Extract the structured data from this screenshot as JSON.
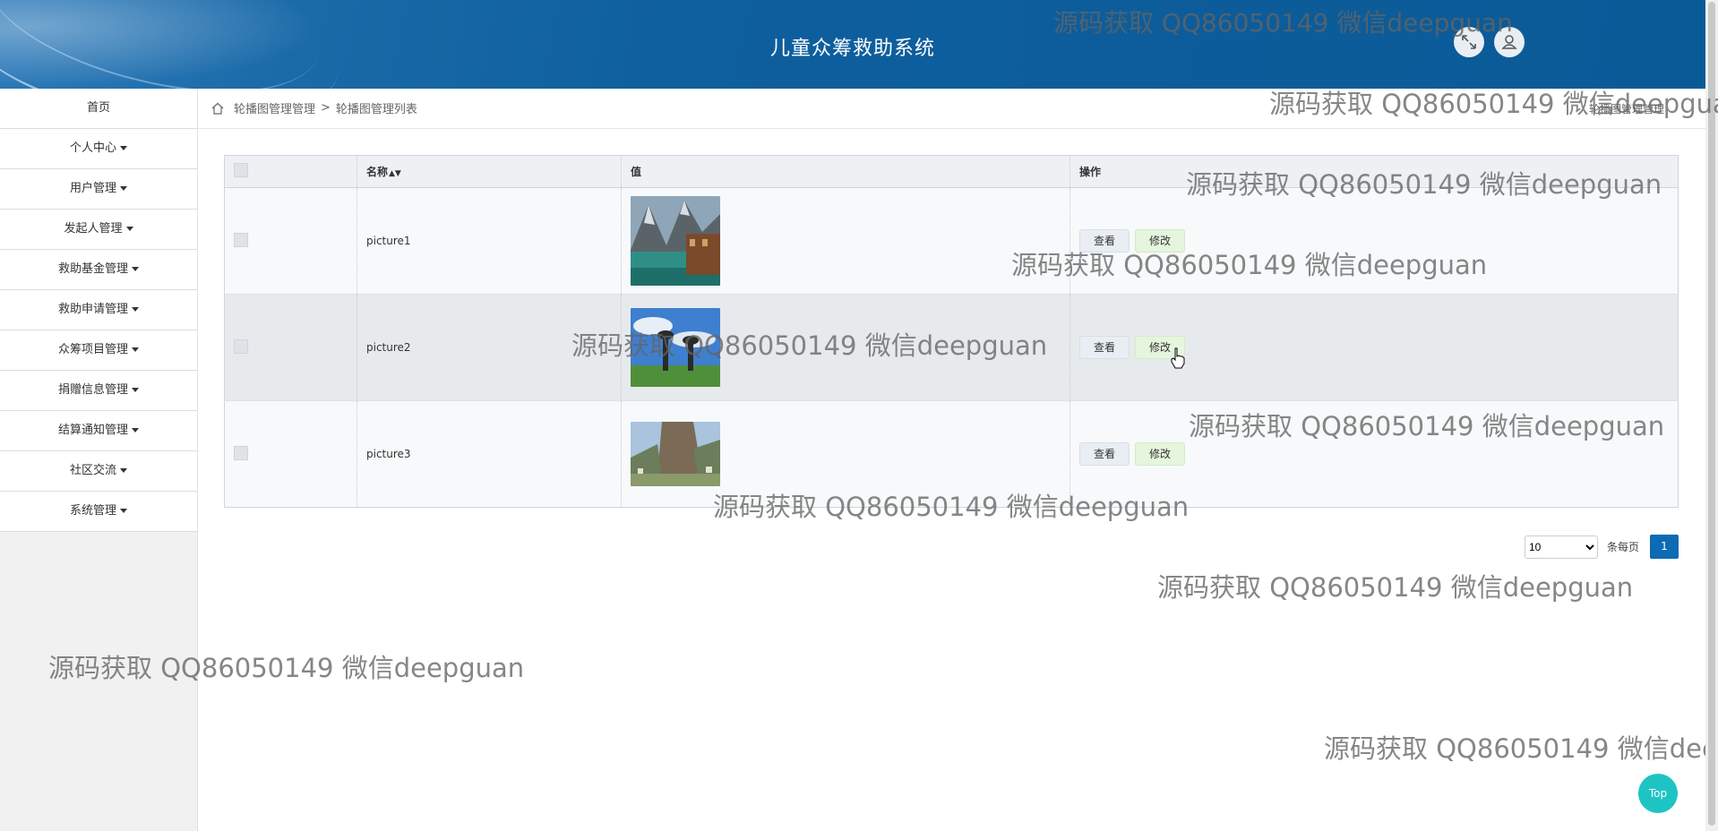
{
  "header": {
    "title": "儿童众筹救助系统"
  },
  "sidebar": {
    "items": [
      {
        "label": "首页",
        "dropdown": false
      },
      {
        "label": "个人中心",
        "dropdown": true
      },
      {
        "label": "用户管理",
        "dropdown": true
      },
      {
        "label": "发起人管理",
        "dropdown": true
      },
      {
        "label": "救助基金管理",
        "dropdown": true
      },
      {
        "label": "救助申请管理",
        "dropdown": true
      },
      {
        "label": "众筹项目管理",
        "dropdown": true
      },
      {
        "label": "捐赠信息管理",
        "dropdown": true
      },
      {
        "label": "结算通知管理",
        "dropdown": true
      },
      {
        "label": "社区交流",
        "dropdown": true
      },
      {
        "label": "系统管理",
        "dropdown": true
      }
    ]
  },
  "breadcrumb": {
    "level1": "轮播图管理管理",
    "separator": ">",
    "level2": "轮播图管理列表",
    "right": "轮播图管理管理"
  },
  "table": {
    "columns": {
      "name": "名称",
      "value": "值",
      "actions": "操作"
    },
    "rows": [
      {
        "name": "picture1",
        "image": "mountain-lake-photo"
      },
      {
        "name": "picture2",
        "image": "tree-sky-photo"
      },
      {
        "name": "picture3",
        "image": "cliff-village-photo"
      }
    ],
    "view_label": "查看",
    "edit_label": "修改"
  },
  "pagination": {
    "page_size": "10",
    "per_page_label": "条每页",
    "current_page": "1"
  },
  "watermark": "源码获取 QQ86050149 微信deepguan",
  "top_button": "Top",
  "colors": {
    "header": "#0b5a98",
    "accent": "#0d6bb3",
    "top_button": "#1ec4c4"
  }
}
